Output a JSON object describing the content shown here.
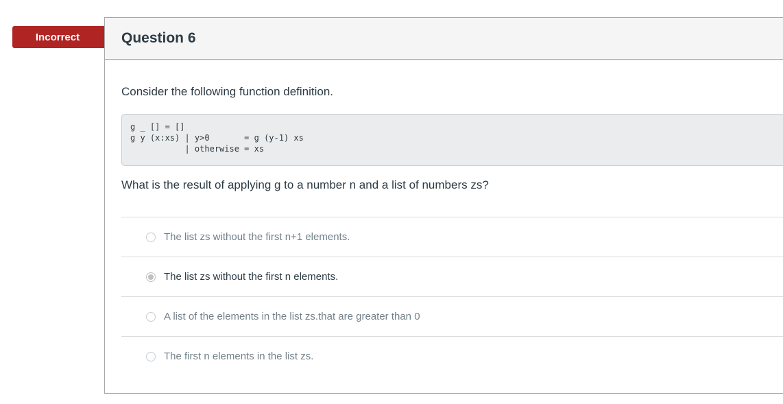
{
  "status_badge": "Incorrect",
  "question": {
    "title": "Question 6",
    "intro": "Consider the following function definition.",
    "code": "g _ [] = []\ng y (x:xs) | y>0       = g (y-1) xs\n           | otherwise = xs",
    "prompt": "What is the result of applying g to a number n and a list of numbers zs?",
    "answers": [
      {
        "label": "The list zs without the first n+1 elements.",
        "selected": false
      },
      {
        "label": "The list zs without the first n elements.",
        "selected": true
      },
      {
        "label": "A list of the elements in the list zs.that are greater than 0",
        "selected": false
      },
      {
        "label": "The first n elements in the list zs.",
        "selected": false
      }
    ]
  }
}
